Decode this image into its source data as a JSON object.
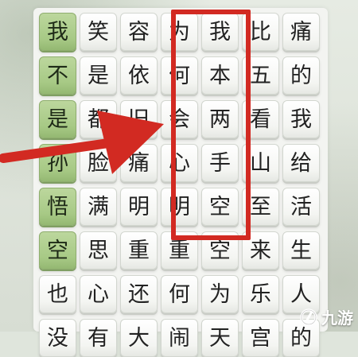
{
  "tiles": [
    [
      {
        "char": "我",
        "green": true
      },
      {
        "char": "笑"
      },
      {
        "char": "容"
      },
      {
        "char": "为"
      },
      {
        "char": "我"
      },
      {
        "char": "比"
      },
      {
        "char": "痛"
      }
    ],
    [
      {
        "char": "不",
        "green": true
      },
      {
        "char": "是"
      },
      {
        "char": "依"
      },
      {
        "char": "何"
      },
      {
        "char": "本"
      },
      {
        "char": "五"
      },
      {
        "char": "的"
      }
    ],
    [
      {
        "char": "是",
        "green": true
      },
      {
        "char": "都"
      },
      {
        "char": "旧"
      },
      {
        "char": "会"
      },
      {
        "char": "两"
      },
      {
        "char": "看"
      },
      {
        "char": "我"
      }
    ],
    [
      {
        "char": "孙",
        "green": true
      },
      {
        "char": "脸"
      },
      {
        "char": "痛"
      },
      {
        "char": "心"
      },
      {
        "char": "手"
      },
      {
        "char": "山"
      },
      {
        "char": "给"
      }
    ],
    [
      {
        "char": "悟",
        "green": true
      },
      {
        "char": "满"
      },
      {
        "char": "明"
      },
      {
        "char": "明"
      },
      {
        "char": "空"
      },
      {
        "char": "至"
      },
      {
        "char": "活"
      }
    ],
    [
      {
        "char": "空",
        "green": true
      },
      {
        "char": "思"
      },
      {
        "char": "重"
      },
      {
        "char": "重"
      },
      {
        "char": "空"
      },
      {
        "char": "来"
      },
      {
        "char": "生"
      }
    ],
    [
      {
        "char": "也"
      },
      {
        "char": "心"
      },
      {
        "char": "还"
      },
      {
        "char": "何"
      },
      {
        "char": "为"
      },
      {
        "char": "乐"
      },
      {
        "char": "人"
      }
    ],
    [
      {
        "char": "没"
      },
      {
        "char": "有"
      },
      {
        "char": "大"
      },
      {
        "char": "闹"
      },
      {
        "char": "天"
      },
      {
        "char": "宫"
      },
      {
        "char": "的"
      }
    ]
  ],
  "annotation": {
    "box_color": "#d22a22",
    "arrow_color": "#d22a22"
  },
  "watermark": {
    "text": "九游"
  }
}
